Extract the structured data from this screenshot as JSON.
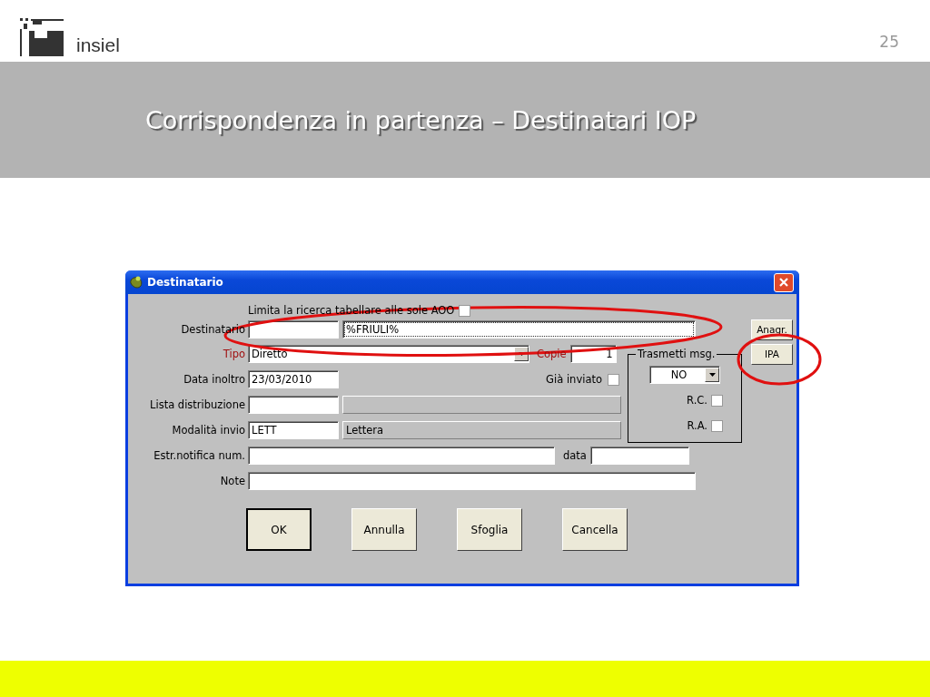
{
  "slide": {
    "logo_text": "insiel",
    "page_number": "25",
    "title": "Corrispondenza in partenza – Destinatari IOP"
  },
  "dialog": {
    "title": "Destinatario",
    "limit_option": {
      "label": "Limita la ricerca tabellare alle sole AOO",
      "checked": false
    },
    "destinatario": {
      "label": "Destinatario",
      "value": "%FRIULI%"
    },
    "tipo": {
      "label": "Tipo",
      "value": "Diretto",
      "required": true
    },
    "copie": {
      "label": "Copie",
      "value": "1",
      "required": true
    },
    "data_inoltro": {
      "label": "Data inoltro",
      "value": "23/03/2010"
    },
    "gia_inviato": {
      "label": "Già inviato",
      "checked": false
    },
    "lista_distribuzione": {
      "label": "Lista distribuzione"
    },
    "modalita_invio": {
      "label": "Modalità invio",
      "code": "LETT",
      "value": "Lettera"
    },
    "estr_notifica": {
      "label": "Estr.notifica num."
    },
    "data": {
      "label": "data"
    },
    "note": {
      "label": "Note"
    },
    "trasmetti": {
      "label": "Trasmetti msg.",
      "value": "NO",
      "options": [
        {
          "label": "R.C.",
          "checked": false
        },
        {
          "label": "R.A.",
          "checked": false
        }
      ]
    },
    "side_buttons": [
      "Anagr.",
      "IPA"
    ],
    "buttons": [
      {
        "label": "OK",
        "default": true
      },
      {
        "label": "Annulla",
        "default": false
      },
      {
        "label": "Sfoglia",
        "default": false
      },
      {
        "label": "Cancella",
        "default": false
      }
    ]
  }
}
